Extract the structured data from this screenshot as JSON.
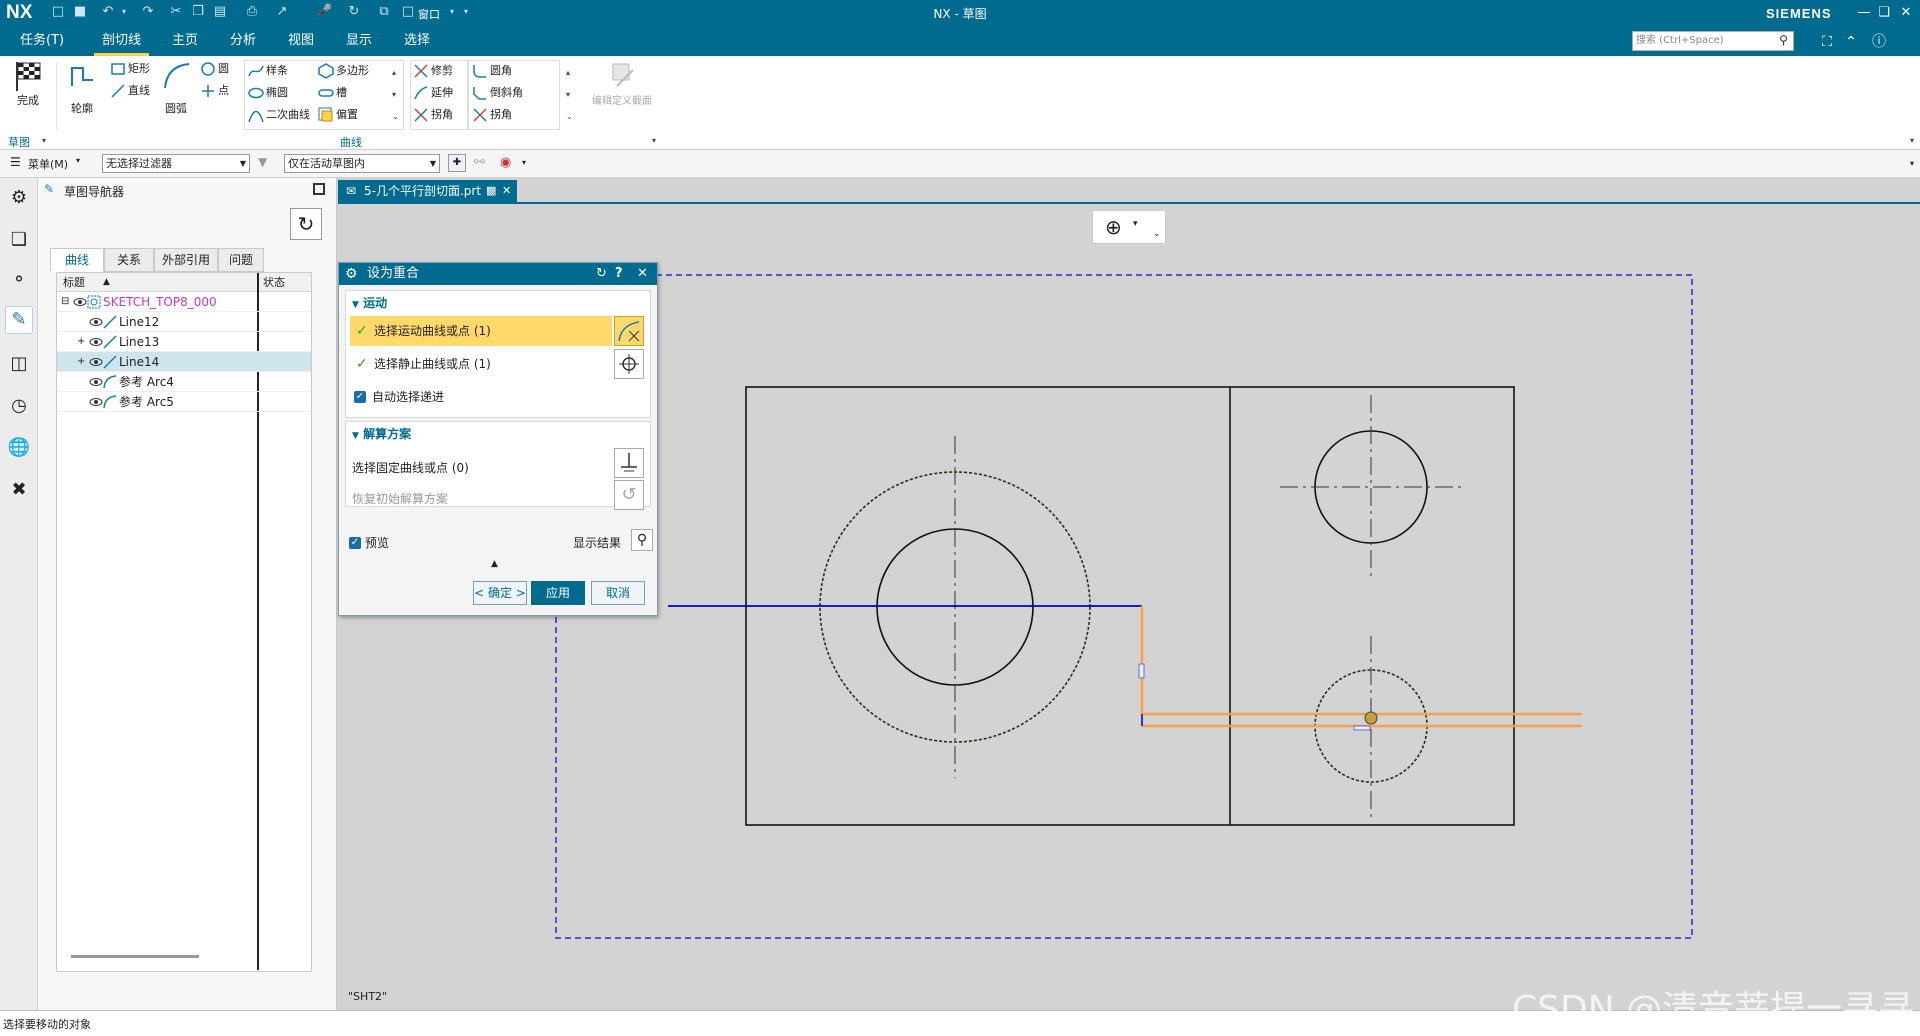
{
  "titlebar": {
    "logo": "NX",
    "title": "NX - 草图",
    "brand": "SIEMENS",
    "window_menu": "窗口"
  },
  "menu": {
    "tabs": [
      "任务(T)",
      "剖切线",
      "主页",
      "分析",
      "视图",
      "显示",
      "选择"
    ],
    "active_tab": "剖切线",
    "search_placeholder": "搜索 (Ctrl+Space)"
  },
  "ribbon": {
    "finish": "完成",
    "profile": "轮廓",
    "rectangle": "矩形",
    "line": "直线",
    "arc": "圆弧",
    "circle": "圆",
    "point": "点",
    "spline": "样条",
    "ellipse": "椭圆",
    "conic": "二次曲线",
    "polygon": "多边形",
    "slot": "槽",
    "offset": "偏置",
    "trim": "修剪",
    "extend": "延伸",
    "corner": "拐角",
    "fillet": "圆角",
    "chamfer": "倒斜角",
    "corner2": "拐角",
    "edit_section": "编辑定义截面",
    "group_sketch": "草图",
    "group_curve": "曲线"
  },
  "filterbar": {
    "menu": "菜单(M)",
    "type_filter": "无选择过滤器",
    "scope_filter": "仅在活动草图内"
  },
  "navigator": {
    "title": "草图导航器",
    "tabs": [
      "曲线",
      "关系",
      "外部引用",
      "问题"
    ],
    "columns": {
      "title": "标题",
      "state": "状态"
    },
    "root": "SKETCH_TOP8_000",
    "items": [
      "Line12",
      "Line13",
      "Line14",
      "参考 Arc4",
      "参考 Arc5"
    ],
    "selected_item": "Line14"
  },
  "document": {
    "tab": "5-几个平行剖切面.prt",
    "sheet_label": "\"SHT2\""
  },
  "dialog": {
    "title": "设为重合",
    "motion_section": "运动",
    "select_motion": "选择运动曲线或点 (1)",
    "select_stationary": "选择静止曲线或点 (1)",
    "auto_advance": "自动选择递进",
    "solution_section": "解算方案",
    "select_fixed": "选择固定曲线或点 (0)",
    "restore_solution": "恢复初始解算方案",
    "preview": "预览",
    "show_result": "显示结果",
    "ok": "< 确定 >",
    "apply": "应用",
    "cancel": "取消"
  },
  "status": {
    "message": "选择要移动的对象"
  },
  "watermark": "CSDN @清音菩提一寻寻",
  "colors": {
    "accent": "#006b8f",
    "highlight": "#ffd96b",
    "selection_line": "#0000c8",
    "preview_line": "#f7a14a"
  }
}
